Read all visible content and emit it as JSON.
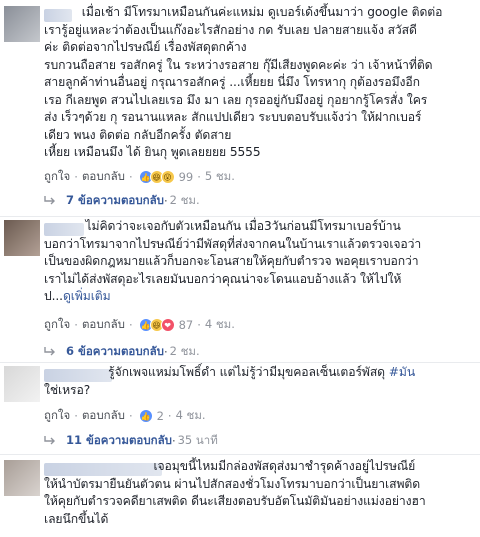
{
  "comments": [
    {
      "text": "          เมื่อเช้า มีโทรมาเหมือนกันค่ะแหม่ม ดูเบอร์เด้งขึ้นมาว่า google ติดต่อ\nเรารู้อยู่แหละว่าต้องเป็นแก๊งอะไรสักอย่าง กด รับเลย ปลายสายแจ้ง สวัสดี\nค่ะ ติดต่อจากไปรษณีย์ เรื่องพัสดุตกค้าง\nรบกวนถือสาย รอสักครู่ ใน ระหว่างรอสาย กุ๊มีเสียงพูดคะค่ะ ว่า เจ้าหน้าที่ติด\nสายลูกค้าท่านอื่นอยู่ กรุณารอสักครู่ ...เหี้ยยย นี่มึง โทรหากุ กุต้องรอมึงอีก\nเรอ กีเลยพูด สวนไปเลยเรอ มึง มา เลย กุรออยู่กับมึงอยู่ กุอยากรู้โครสั่ง ใคร\nส่ง เร็วๆด้วย กุ รอนานแหละ สักแปปเดียว ระบบตอบรับแจ้งว่า ให้ฝากเบอร์\nเดียว พนง ติดต่อ กลับอีกครั้ง ตัดสาย\nเหี้ยย เหมือนมึง ได้ ยินกุ พูดเลยยยย 5555",
      "like": "ถูกใจ",
      "reply": "ตอบกลับ",
      "reaction_count": "99",
      "time": "5 ชม.",
      "replies_label": "7 ข้อความตอบกลับ",
      "replies_time": "2 ชม."
    },
    {
      "text": "           ไม่คิดว่าจะเจอกับตัวเหมือนกัน เมื่อ3วันก่อนมีโทรมาเบอร์บ้าน\nบอกว่าโทรมาจากไปรษณีย์ว่ามีพัสดุที่ส่งจากคนในบ้านเราแล้วตรวจเจอว่า\nเป็นของผิดกฎหมายแล้วก็บอกจะโอนสายให้คุยกับตำรวจ พอคุยเราบอกว่า\nเราไม่ได้ส่งพัสดุอะไรเลยมันบอกว่าคุณน่าจะโดนแอบอ้างแล้ว ให้ไปให้\nป...",
      "see_more": "ดูเพิ่มเติม",
      "like": "ถูกใจ",
      "reply": "ตอบกลับ",
      "reaction_count": "87",
      "time": "4 ชม.",
      "replies_label": "6 ข้อความตอบกลับ",
      "replies_time": "2 ชม."
    },
    {
      "text": "                 รู้จักเพจแหม่มโพธิ์ดำ แต่ไม่รู้ว่ามีมุขคอลเซ็นเตอร์พัสดุ ",
      "hashtag": "#มัน",
      "text2": "ใช่เหรอ?",
      "like": "ถูกใจ",
      "reply": "ตอบกลับ",
      "reaction_count": "2",
      "time": "4 ชม.",
      "replies_label": "11 ข้อความตอบกลับ",
      "replies_time": "35 นาที"
    },
    {
      "text": "                             เจอมุขนี้ไหมมีกล่องพัสดุส่งมาชำรุดค้างอยู่ไปรษณีย์\nให้นำบัตรมายืนยันตัวตน ผ่านไปสักสองชั่วโมงโทรมาบอกว่าเป็นยาเสพติด\nให้คุยกับตำรวจคดียาเสพติด ดีนะเสียงตอบรับอัตโนมัติมันอย่างแม่งอย่างฮา\nเลยนึกขึ้นได้"
    }
  ],
  "icons": {
    "like": "👍",
    "haha": "😆",
    "wow": "😮",
    "love": "❤"
  }
}
